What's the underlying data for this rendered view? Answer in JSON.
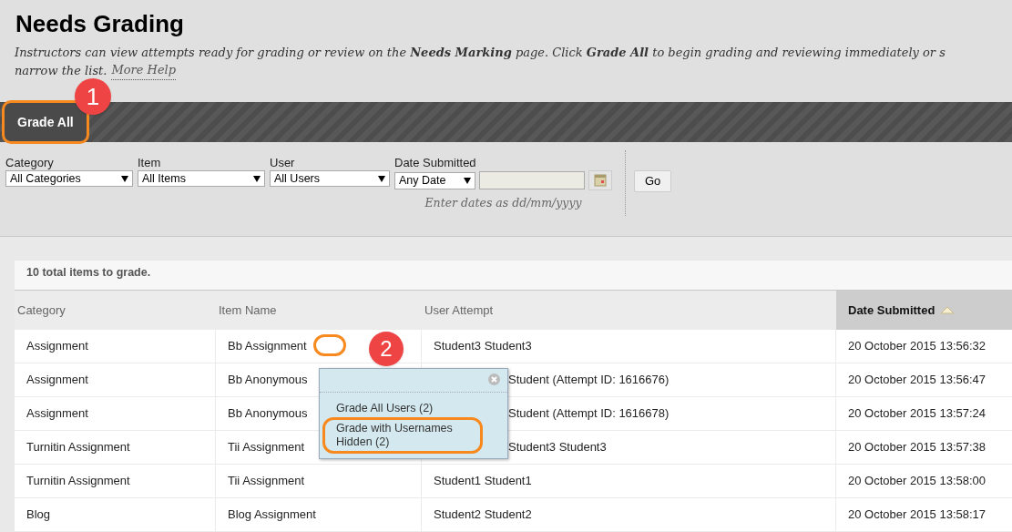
{
  "page": {
    "title": "Needs Grading",
    "description": "Instructors can view attempts ready for grading or review on the **Needs Marking** page. Click **Grade All** to begin grading and reviewing immediately or s",
    "description_end": "narrow the list.",
    "help_link": "More Help"
  },
  "action_bar": {
    "button": "Grade All",
    "callout": "1"
  },
  "filters": [
    {
      "label": "Category",
      "value": "All Categories"
    },
    {
      "label": "Item",
      "value": "All Items"
    },
    {
      "label": "User",
      "value": "All Users"
    }
  ],
  "date_filter": {
    "label": "Date Submitted",
    "value": "Any Date",
    "hint": "Enter dates as dd/mm/yyyy"
  },
  "go_button": "Go",
  "summary": "10 total items to grade.",
  "table": {
    "columns": [
      {
        "label": "Category",
        "sorted": false
      },
      {
        "label": "Item Name",
        "sorted": false
      },
      {
        "label": "User Attempt",
        "sorted": false
      },
      {
        "label": "Date Submitted",
        "sorted": true
      }
    ],
    "rows": [
      [
        "Assignment",
        "Bb Assignment",
        "Student3 Student3",
        "20 October 2015 13:56:32"
      ],
      [
        "Assignment",
        "Bb Anonymous",
        "Student (Attempt ID: 1616676)",
        "20 October 2015 13:56:47"
      ],
      [
        "Assignment",
        "Bb Anonymous",
        "Student (Attempt ID: 1616678)",
        "20 October 2015 13:57:24"
      ],
      [
        "Turnitin Assignment",
        "Tii Assignment",
        "Student3 Student3",
        "20 October 2015 13:57:38"
      ],
      [
        "Turnitin Assignment",
        "Tii Assignment",
        "Student1 Student1",
        "20 October 2015 13:58:00"
      ],
      [
        "Blog",
        "Blog Assignment",
        "Student2 Student2",
        "20 October 2015 13:58:17"
      ]
    ]
  },
  "popup_menu": {
    "callout": "2",
    "items": [
      {
        "label": "Grade All Users (2)",
        "highlighted": false
      },
      {
        "label": "Grade with Usernames Hidden (2)",
        "highlighted": true
      }
    ]
  }
}
